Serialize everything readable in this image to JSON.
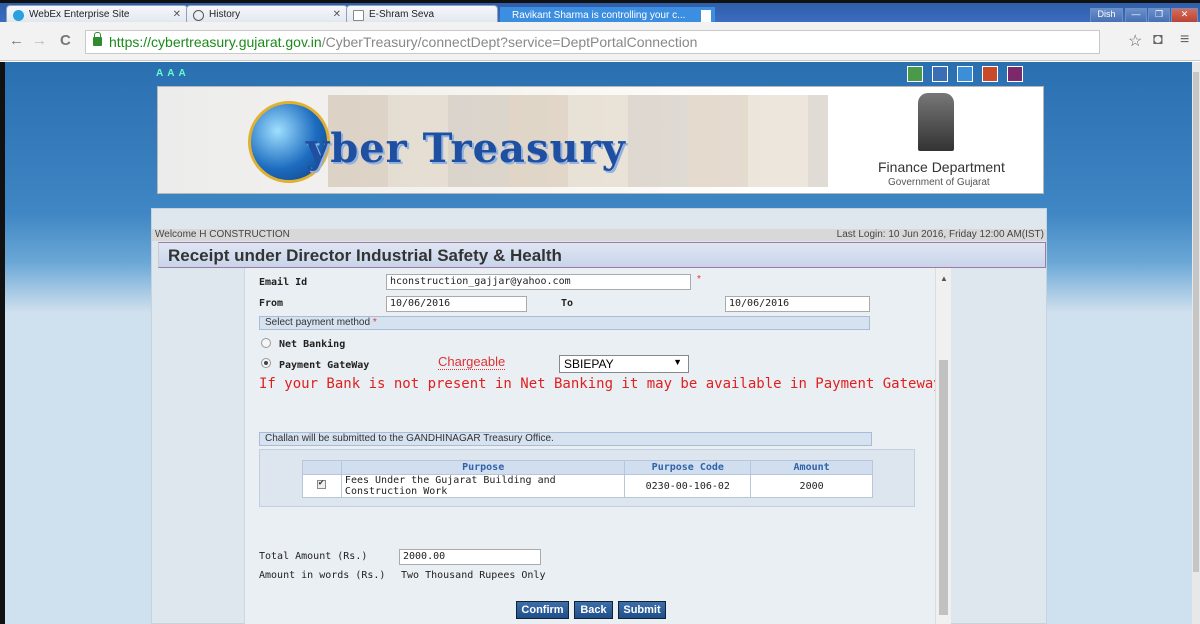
{
  "browser": {
    "tabs": [
      {
        "label": "WebEx Enterprise Site",
        "icon": "webex-icon"
      },
      {
        "label": "History",
        "icon": "history-icon"
      },
      {
        "label": "E-Shram Seva",
        "icon": "page-icon"
      }
    ],
    "sharing_banner": "Ravikant Sharma is controlling your c...",
    "profile_label": "Dish",
    "url_scheme": "https://",
    "url_host": "cybertreasury.gujarat.gov.in",
    "url_path": "/CyberTreasury/connectDept?service=DeptPortalConnection"
  },
  "header": {
    "font_size_control": "A A A",
    "site_title": "yber Treasury",
    "dept_name": "Finance Department",
    "gov_name": "Government of Gujarat"
  },
  "welcome": {
    "text": "Welcome H CONSTRUCTION",
    "last_login": "Last Login: 10 Jun 2016, Friday 12:00 AM(IST)"
  },
  "page_title": "Receipt under Director Industrial Safety & Health",
  "form": {
    "email_label": "Email Id",
    "email_value": "hconstruction_gajjar@yahoo.com",
    "required_mark": "*",
    "from_label": "From",
    "from_value": "10/06/2016",
    "to_label": "To",
    "to_value": "10/06/2016",
    "payment_method_label": "Select payment method",
    "net_banking_label": "Net Banking",
    "payment_gateway_label": "Payment GateWay",
    "chargeable_label": "Chargeable",
    "gateway_selected": "SBIEPAY",
    "warning_text": "If your Bank is not present in Net Banking it may be available in Payment Gateway",
    "challan_text": "Challan will be submitted to the GANDHINAGAR Treasury Office."
  },
  "table": {
    "headers": [
      "Purpose",
      "Purpose Code",
      "Amount"
    ],
    "rows": [
      {
        "purpose": "Fees Under the Gujarat Building and Construction Work",
        "code": "0230-00-106-02",
        "amount": "2000"
      }
    ]
  },
  "totals": {
    "total_label": "Total Amount (Rs.)",
    "total_value": "2000.00",
    "words_label": "Amount in words (Rs.)",
    "words_value": "Two Thousand Rupees Only"
  },
  "buttons": {
    "confirm": "Confirm",
    "back": "Back",
    "submit": "Submit"
  },
  "colors": {
    "title_bar": "#c8d4ea",
    "warning": "#e02020",
    "button": "#1f4f8a"
  }
}
